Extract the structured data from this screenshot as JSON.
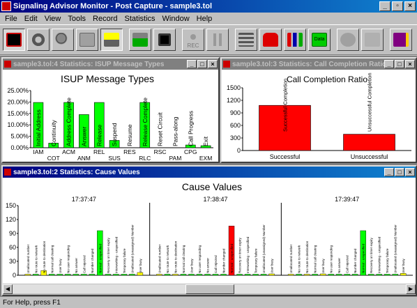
{
  "app": {
    "title": "Signaling Advisor Monitor - Post Capture - sample3.tol",
    "min": "_",
    "restore": "▫",
    "close": "×"
  },
  "menu": [
    "File",
    "Edit",
    "View",
    "Tools",
    "Record",
    "Statistics",
    "Window",
    "Help"
  ],
  "toolbar": {
    "rec_label": "REC",
    "data_label": "Data"
  },
  "win_isup": {
    "title": "sample3.tol:4 Statistics: ISUP Message Types",
    "chart_title": "ISUP Message Types",
    "chart_data": {
      "type": "bar",
      "categories": [
        "IAM",
        "COT",
        "ACM",
        "ANM",
        "REL",
        "SUS",
        "RES",
        "RLC",
        "RSC",
        "PAM",
        "CPG",
        "EXM"
      ],
      "bar_labels": [
        "Initial Address",
        "Continuity",
        "Address Complete",
        "Answer",
        "Release",
        "Suspend",
        "Resume",
        "Release Complete",
        "Reset Circuit",
        "Pass-along",
        "Call Progress",
        "Exit"
      ],
      "values": [
        19.8,
        2.0,
        19.8,
        14.5,
        19.8,
        3.2,
        0,
        19.8,
        0,
        0,
        1.2,
        0.9
      ],
      "ylim": [
        0,
        25
      ],
      "yticks": [
        "0.00%",
        "5.00%",
        "10.00%",
        "15.00%",
        "20.00%",
        "25.00%"
      ],
      "color": "#00ff00"
    }
  },
  "win_ccr": {
    "title": "sample3.tol:3 Statistics: Call Completion Ratio",
    "chart_title": "Call Completion Ratio",
    "chart_data": {
      "type": "bar",
      "categories": [
        "Successful",
        "Unsuccessful"
      ],
      "bar_labels": [
        "Successful Completion",
        "Unsuccessful Completion"
      ],
      "values": [
        1080,
        390
      ],
      "ylim": [
        0,
        1500
      ],
      "yticks": [
        "0",
        "300",
        "600",
        "900",
        "1200",
        "1500"
      ],
      "color": "#ff0000"
    }
  },
  "win_cause": {
    "title": "sample3.tol:2 Statistics: Cause Values",
    "chart_title": "Cause Values",
    "chart_data": {
      "type": "bar",
      "ylim": [
        0,
        150
      ],
      "yticks": [
        "0",
        "30",
        "60",
        "90",
        "120",
        "150"
      ],
      "labels": [
        "Unallocated number",
        "No route to network",
        "No route to destination",
        "Normal call clearing",
        "User busy",
        "No user responding",
        "No answer",
        "Call rejected",
        "Number changed",
        "Normal - unspecified",
        "Recovery on timer expiry",
        "Interworking - unspecified",
        "Temporary failure",
        "Unallocated (unassigned) Number",
        "User busy"
      ],
      "groups": [
        {
          "time": "17:37:47",
          "values": [
            2,
            0,
            10,
            0,
            0,
            0,
            0,
            0,
            0,
            96,
            0,
            0,
            0,
            0,
            6
          ],
          "colors": [
            "#ffff00",
            "#00ff00",
            "#ffff00",
            "#00ff00",
            "#00ff00",
            "#00ff00",
            "#00ff00",
            "#00ff00",
            "#00ff00",
            "#00ff00",
            "#00ff00",
            "#00ff00",
            "#00ff00",
            "#00ff00",
            "#ffff00"
          ]
        },
        {
          "time": "17:38:47",
          "values": [
            0,
            0,
            0,
            0,
            0,
            0,
            0,
            0,
            0,
            106,
            0,
            0,
            0,
            0,
            3
          ],
          "colors": [
            "#ffff00",
            "#00ff00",
            "#ffff00",
            "#00ff00",
            "#00ff00",
            "#00ff00",
            "#00ff00",
            "#00ff00",
            "#00ff00",
            "#ff0000",
            "#00ff00",
            "#00ff00",
            "#00ff00",
            "#00ff00",
            "#ffff00"
          ]
        },
        {
          "time": "17:39:47",
          "values": [
            2,
            0,
            0,
            0,
            3,
            0,
            0,
            0,
            0,
            96,
            0,
            0,
            0,
            0,
            4
          ],
          "colors": [
            "#ffff00",
            "#00ff00",
            "#ffff00",
            "#00ff00",
            "#ffff00",
            "#00ff00",
            "#00ff00",
            "#00ff00",
            "#00ff00",
            "#00ff00",
            "#00ff00",
            "#00ff00",
            "#00ff00",
            "#00ff00",
            "#ffff00"
          ]
        }
      ]
    }
  },
  "status": "For Help, press F1"
}
